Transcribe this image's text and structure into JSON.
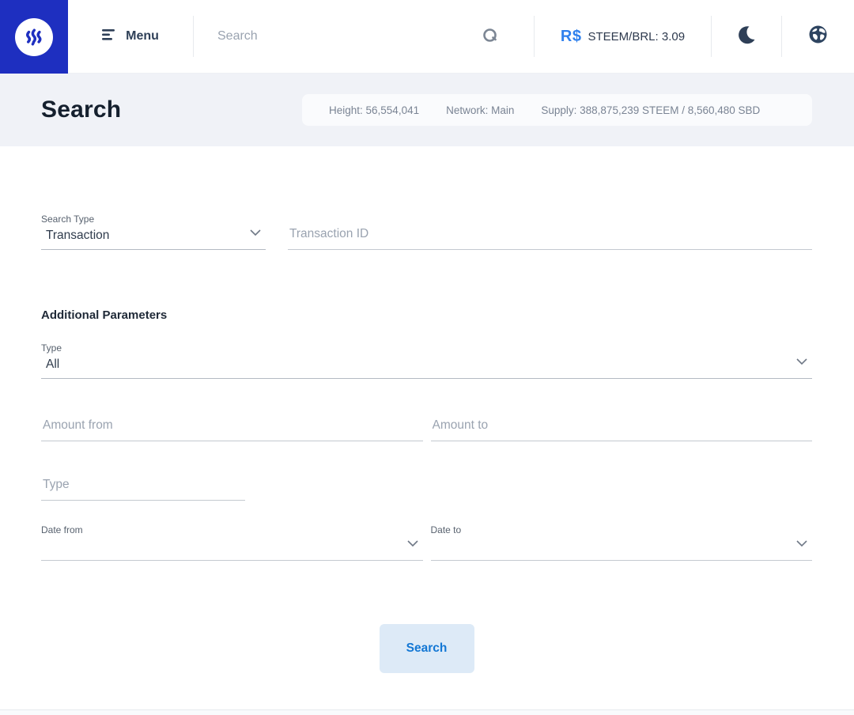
{
  "navbar": {
    "menu": {
      "label": "Menu"
    },
    "search": {
      "placeholder": "Search",
      "value": ""
    },
    "price": {
      "symbol": "R$",
      "label": "STEEM/BRL: 3.09"
    }
  },
  "header": {
    "title": "Search",
    "stats": [
      {
        "text": "Height: 56,554,041"
      },
      {
        "text": "Network: Main"
      },
      {
        "text": "Supply: 388,875,239 STEEM / 8,560,480 SBD"
      }
    ]
  },
  "form": {
    "search_type": {
      "label": "Search Type",
      "value": "Transaction"
    },
    "transaction_id": {
      "placeholder": "Transaction ID",
      "value": ""
    },
    "additional_parameters_title": "Additional Parameters",
    "op_type": {
      "label": "Type",
      "value": "All"
    },
    "amount_from": {
      "placeholder": "Amount from",
      "value": ""
    },
    "amount_to": {
      "placeholder": "Amount to",
      "value": ""
    },
    "type_filter": {
      "placeholder": "Type",
      "value": ""
    },
    "date_from": {
      "label": "Date from",
      "value": ""
    },
    "date_to": {
      "label": "Date to",
      "value": ""
    },
    "submit_label": "Search"
  },
  "colors": {
    "brand_blue": "#1e2fc0",
    "accent_blue": "#2f80ed",
    "header_bg": "#f0f2f7",
    "button_bg": "#ddeaf7",
    "button_text": "#1377d4",
    "icon_navy": "#2e3f57",
    "placeholder_gray": "#9aa3b0"
  }
}
